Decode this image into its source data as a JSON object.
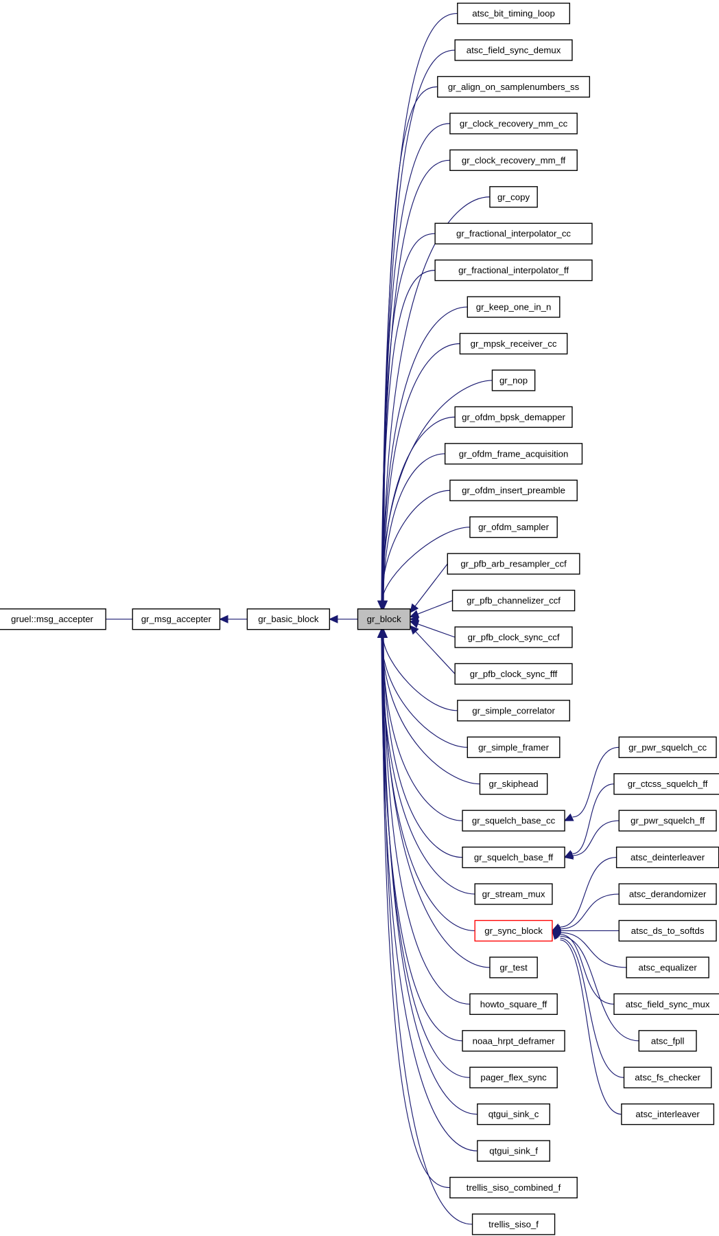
{
  "diagram": {
    "type": "inheritance-graph",
    "edge_color": "#191970",
    "current_node_fill": "#bfbfbf",
    "highlight_color": "#ff0000",
    "chain": [
      "gruel::msg_accepter",
      "gr_msg_accepter",
      "gr_basic_block",
      "gr_block"
    ],
    "current": "gr_block",
    "children_of_gr_block": [
      "atsc_bit_timing_loop",
      "atsc_field_sync_demux",
      "gr_align_on_samplenumbers_ss",
      "gr_clock_recovery_mm_cc",
      "gr_clock_recovery_mm_ff",
      "gr_copy",
      "gr_fractional_interpolator_cc",
      "gr_fractional_interpolator_ff",
      "gr_keep_one_in_n",
      "gr_mpsk_receiver_cc",
      "gr_nop",
      "gr_ofdm_bpsk_demapper",
      "gr_ofdm_frame_acquisition",
      "gr_ofdm_insert_preamble",
      "gr_ofdm_sampler",
      "gr_pfb_arb_resampler_ccf",
      "gr_pfb_channelizer_ccf",
      "gr_pfb_clock_sync_ccf",
      "gr_pfb_clock_sync_fff",
      "gr_simple_correlator",
      "gr_simple_framer",
      "gr_skiphead",
      "gr_squelch_base_cc",
      "gr_squelch_base_ff",
      "gr_stream_mux",
      "gr_sync_block",
      "gr_test",
      "howto_square_ff",
      "noaa_hrpt_deframer",
      "pager_flex_sync",
      "qtgui_sink_c",
      "qtgui_sink_f",
      "trellis_siso_combined_f",
      "trellis_siso_f"
    ],
    "highlighted": "gr_sync_block",
    "children_of_gr_squelch_base_cc": [
      "gr_pwr_squelch_cc"
    ],
    "children_of_gr_squelch_base_ff": [
      "gr_ctcss_squelch_ff",
      "gr_pwr_squelch_ff"
    ],
    "children_of_gr_sync_block": [
      "atsc_deinterleaver",
      "atsc_derandomizer",
      "atsc_ds_to_softds",
      "atsc_equalizer",
      "atsc_field_sync_mux",
      "atsc_fpll",
      "atsc_fs_checker",
      "atsc_interleaver"
    ]
  }
}
